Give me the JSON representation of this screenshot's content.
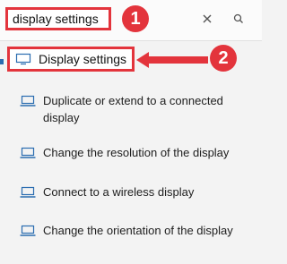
{
  "search": {
    "value": "display settings",
    "clear_icon": "close-icon",
    "search_icon": "search-icon"
  },
  "callouts": {
    "first": "1",
    "second": "2"
  },
  "results": [
    {
      "label": "Display settings",
      "icon": "monitor-icon"
    },
    {
      "label": "Duplicate or extend to a connected display",
      "icon": "laptop-icon"
    },
    {
      "label": "Change the resolution of the display",
      "icon": "laptop-icon"
    },
    {
      "label": "Connect to a wireless display",
      "icon": "laptop-icon"
    },
    {
      "label": "Change the orientation of the display",
      "icon": "laptop-icon"
    }
  ],
  "colors": {
    "highlight": "#e3343c",
    "icon": "#2a6cb0"
  }
}
